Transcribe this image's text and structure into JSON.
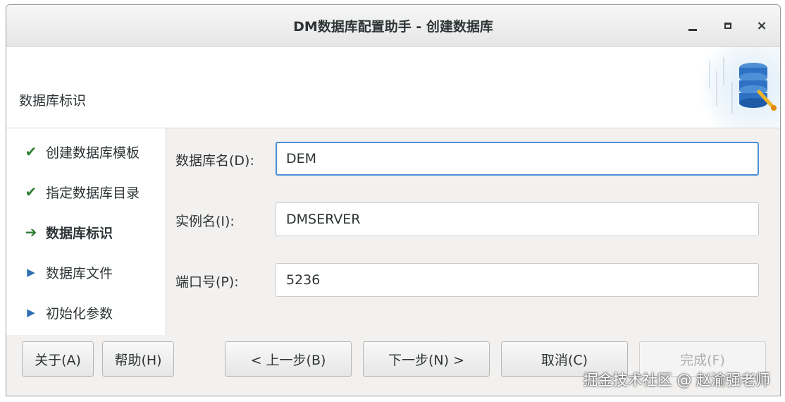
{
  "window": {
    "title": "DM数据库配置助手 - 创建数据库",
    "controls": {
      "minimize": "minimize",
      "maximize": "maximize",
      "close": "×"
    }
  },
  "header": {
    "section_title": "数据库标识",
    "graphic_icon": "database-config-icon"
  },
  "steps": [
    {
      "label": "创建数据库模板",
      "status": "done",
      "icon": "check-icon"
    },
    {
      "label": "指定数据库目录",
      "status": "done",
      "icon": "check-icon"
    },
    {
      "label": "数据库标识",
      "status": "current",
      "icon": "arrow-right-icon"
    },
    {
      "label": "数据库文件",
      "status": "pending",
      "icon": "triangle-right-icon"
    },
    {
      "label": "初始化参数",
      "status": "pending",
      "icon": "triangle-right-icon"
    }
  ],
  "form": {
    "db_name": {
      "label": "数据库名(D):",
      "value": "DEM"
    },
    "instance_name": {
      "label": "实例名(I):",
      "value": "DMSERVER"
    },
    "port": {
      "label": "端口号(P):",
      "value": "5236"
    }
  },
  "buttons": {
    "about": "关于(A)",
    "help": "帮助(H)",
    "prev": "< 上一步(B)",
    "next": "下一步(N) >",
    "cancel": "取消(C)",
    "finish": "完成(F)"
  },
  "watermark": "掘金技术社区 @ 赵渝强老师",
  "colors": {
    "check": "#2e7d32",
    "pending_arrow": "#2f6fb3",
    "focus_border": "#4a90d9"
  }
}
